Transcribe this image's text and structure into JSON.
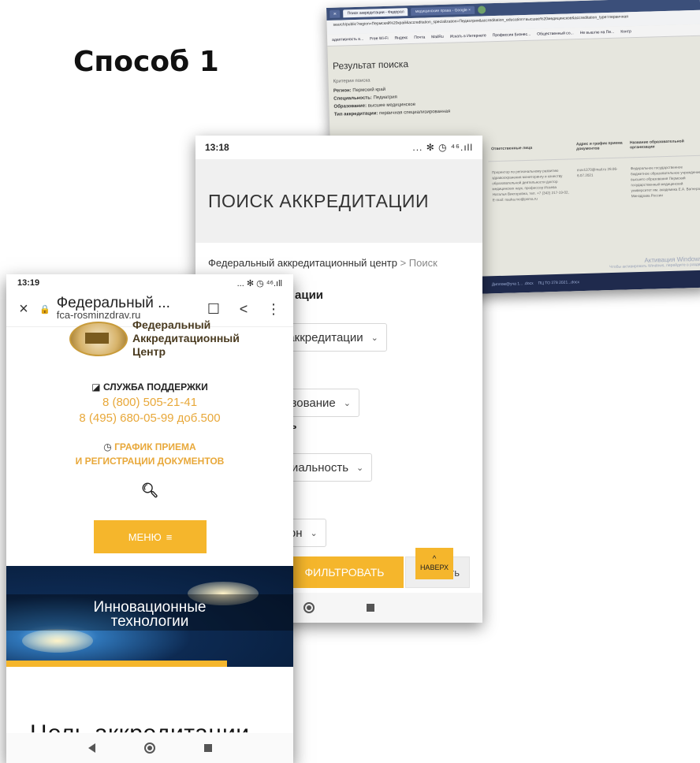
{
  "slide": {
    "title": "Способ 1"
  },
  "laptop": {
    "tabs": [
      "ж",
      "Поиск аккредитации - Федерал",
      "медицинские права - Google ×"
    ],
    "url": "search/public?region=Пермский%20край&accreditation_specialization=Педиатрия&accreditation_education=высшее%20медицинское&accreditation_type=первичная",
    "bookmarks": [
      "адаптивность в...",
      "Free Wi-Fi",
      "Яндекс",
      "Почта",
      "MailRu",
      "Искать в Интернете",
      "Профессия Бизнес...",
      "Общественный со...",
      "Не вышлю на Пе...",
      "Контр"
    ],
    "heading": "Результат поиска",
    "criteria_label": "Критерии поиска",
    "criteria": [
      {
        "key": "Регион:",
        "value": "Пермский край"
      },
      {
        "key": "Специальность:",
        "value": "Педиатрия"
      },
      {
        "key": "Образование:",
        "value": "высшее медицинское"
      },
      {
        "key": "Тип аккредитации:",
        "value": "первичная специализированная"
      }
    ],
    "columns": [
      "Ответственные лица",
      "Адрес и график приема документов",
      "Название образовательной организации"
    ],
    "row": [
      "Проректор по региональному развитию здравоохранения мониторингу и качеству образовательной деятельности доктор медицинских наук, профессор Исаева Наталья Викторовна, тел. +7 (342) 217-19-02, E-mail: nauka.mo@psma.ru",
      "mov1370@mail.ru 28.06-6.07.2021",
      "Федеральное государственное бюджетное образовательное учреждение высшего образования Пермский государственный медицинский университет им. академика Е.А. Вагнера Минздрава России"
    ],
    "taskbar": [
      "Диплом@уча 1... .docx",
      "ПЦ ТО 378 2021...docx"
    ],
    "activate_title": "Активация Windows",
    "activate_sub": "Чтобы активировать Windows, перейдите в раздел"
  },
  "phone2": {
    "time": "13:18",
    "signal": "... ✻ ◷ ⁴⁶.ıll",
    "hero_title": "ПОИСК АККРЕДИТАЦИИ",
    "crumb_root": "Федеральный аккредитационный центр",
    "crumb_sep": ">",
    "crumb_current": "Поиск аккредитации",
    "section_tail": "ации",
    "select_type": "п аккредитации",
    "select_edu": "разование",
    "label_tail": "ть",
    "select_spec": "ециальность",
    "select_region": "гион",
    "chev": "⌄",
    "filter_btn": "ФИЛЬТРОВАТЬ",
    "reset_btn": "ть",
    "up_caret": "^",
    "up_btn": "НАВЕРХ"
  },
  "phone1": {
    "time": "13:19",
    "signal": "... ✻ ◷ ⁴⁶.ıll",
    "close": "×",
    "lock": "🔒",
    "site_title": "Федеральный ...",
    "domain": "fca-rosminzdrav.ru",
    "bookmark": "☐",
    "share": "<",
    "more": "⋮",
    "logo_line1": "Федеральный",
    "logo_line2": "Аккредитационный",
    "logo_line3": "Центр",
    "support_icon": "◪",
    "support": "СЛУЖБА ПОДДЕРЖКИ",
    "phone_a": "8 (800) 505-21-41",
    "phone_b": "8 (495) 680-05-99 доб.500",
    "clock_icon": "◷",
    "sched_1": "ГРАФИК ПРИЕМА",
    "sched_2": "И РЕГИСТРАЦИИ ДОКУМЕНТОВ",
    "search_icon": "🔍︎",
    "menu_label": "МЕНЮ",
    "menu_icon": "≡",
    "banner_1": "Инновационные",
    "banner_2": "технологии",
    "cut_heading": "Цель аккредитации"
  }
}
